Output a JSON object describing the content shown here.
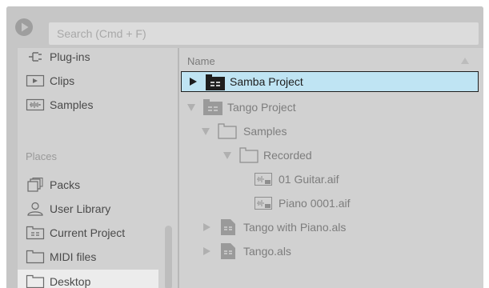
{
  "search": {
    "placeholder": "Search (Cmd + F)"
  },
  "sidebar": {
    "categories": [
      {
        "label": "Plug-ins",
        "icon": "plugin-icon"
      },
      {
        "label": "Clips",
        "icon": "clip-icon"
      },
      {
        "label": "Samples",
        "icon": "sample-icon"
      }
    ],
    "places_heading": "Places",
    "places": [
      {
        "label": "Packs",
        "icon": "packs-icon"
      },
      {
        "label": "User Library",
        "icon": "user-icon"
      },
      {
        "label": "Current Project",
        "icon": "project-folder-icon"
      },
      {
        "label": "MIDI files",
        "icon": "folder-icon"
      },
      {
        "label": "Desktop",
        "icon": "folder-icon",
        "selected": true
      }
    ]
  },
  "browser": {
    "column_header": "Name",
    "items": [
      {
        "label": "Samba Project",
        "type": "project-folder",
        "expanded": false,
        "selected": true
      },
      {
        "label": "Tango Project",
        "type": "project-folder",
        "expanded": true
      },
      {
        "label": "Samples",
        "type": "folder",
        "expanded": true
      },
      {
        "label": "Recorded",
        "type": "folder",
        "expanded": true
      },
      {
        "label": "01 Guitar.aif",
        "type": "audio-file"
      },
      {
        "label": "Piano 0001.aif",
        "type": "audio-file"
      },
      {
        "label": "Tango with Piano.als",
        "type": "live-set",
        "expanded": false
      },
      {
        "label": "Tango.als",
        "type": "live-set",
        "expanded": false
      }
    ]
  },
  "colors": {
    "background": "#c6c6c6",
    "panel": "#d1d1d1",
    "selection": "#bfe4f3",
    "sidebar_selection": "#ececec",
    "text_dim": "#7d7d7d"
  }
}
